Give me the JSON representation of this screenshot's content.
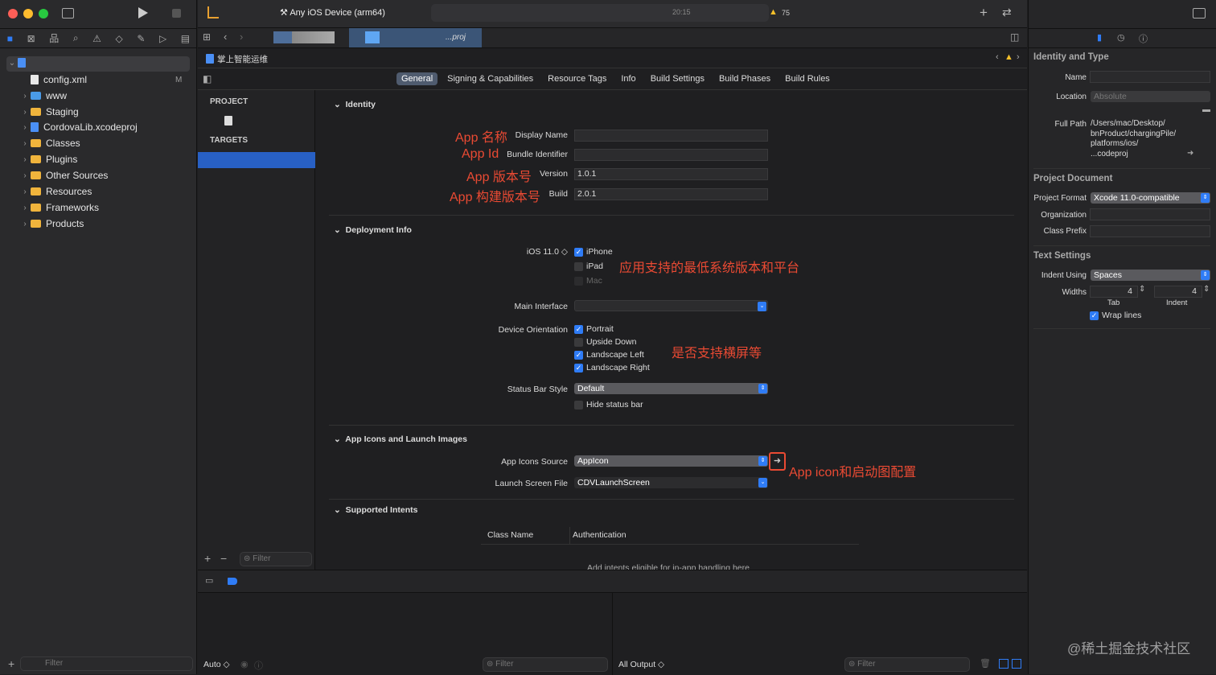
{
  "toolbar": {
    "scheme_device": "Any iOS Device (arm64)",
    "warning_count": "75",
    "time": "20:15"
  },
  "editor_tabs": [
    {
      "label": "...proj"
    }
  ],
  "jump_bar": {
    "title": "掌上智能运维"
  },
  "navigator": {
    "filter_placeholder": "Filter",
    "items": [
      {
        "label": "config.xml",
        "badge": "M"
      },
      {
        "label": "www"
      },
      {
        "label": "Staging"
      },
      {
        "label": "CordovaLib.xcodeproj"
      },
      {
        "label": "Classes"
      },
      {
        "label": "Plugins"
      },
      {
        "label": "Other Sources"
      },
      {
        "label": "Resources"
      },
      {
        "label": "Frameworks"
      },
      {
        "label": "Products"
      }
    ]
  },
  "segments": [
    "General",
    "Signing & Capabilities",
    "Resource Tags",
    "Info",
    "Build Settings",
    "Build Phases",
    "Build Rules"
  ],
  "targets_panel": {
    "project_header": "PROJECT",
    "targets_header": "TARGETS",
    "filter_placeholder": "Filter"
  },
  "identity": {
    "title": "Identity",
    "display_name_label": "Display Name",
    "bundle_id_label": "Bundle Identifier",
    "version_label": "Version",
    "version": "1.0.1",
    "build_label": "Build",
    "build": "2.0.1"
  },
  "deployment": {
    "title": "Deployment Info",
    "ios_version": "iOS 11.0 ◇",
    "iphone": "iPhone",
    "ipad": "iPad",
    "mac": "Mac",
    "main_interface_label": "Main Interface",
    "orientation_label": "Device Orientation",
    "portrait": "Portrait",
    "upside_down": "Upside Down",
    "landscape_left": "Landscape Left",
    "landscape_right": "Landscape Right",
    "status_bar_label": "Status Bar Style",
    "status_bar_value": "Default",
    "hide_status": "Hide status bar"
  },
  "app_icons": {
    "title": "App Icons and Launch Images",
    "icons_source_label": "App Icons Source",
    "icons_source": "AppIcon",
    "launch_label": "Launch Screen File",
    "launch_value": "CDVLaunchScreen"
  },
  "intents": {
    "title": "Supported Intents",
    "col_class": "Class Name",
    "col_auth": "Authentication",
    "empty": "Add intents eligible for in-app handling here"
  },
  "annotations": {
    "app_name": "App 名称",
    "app_id": "App Id",
    "app_version": "App 版本号",
    "app_build": "App 构建版本号",
    "min_os": "应用支持的最低系统版本和平台",
    "landscape": "是否支持横屏等",
    "icon": "App icon和启动图配置"
  },
  "debug": {
    "auto": "Auto ◇",
    "filter": "Filter",
    "all_output": "All Output ◇"
  },
  "inspector": {
    "identity_title": "Identity and Type",
    "name_label": "Name",
    "location_label": "Location",
    "location_value": "Absolute",
    "full_path_label": "Full Path",
    "full_path": [
      "/Users/mac/Desktop/",
      "bnProduct/chargingPile/",
      "platforms/ios/",
      "...codeproj"
    ],
    "project_doc_title": "Project Document",
    "format_label": "Project Format",
    "format_value": "Xcode 11.0-compatible",
    "org_label": "Organization",
    "prefix_label": "Class Prefix",
    "text_title": "Text Settings",
    "indent_using_label": "Indent Using",
    "indent_using": "Spaces",
    "widths_label": "Widths",
    "tab_width": "4",
    "indent_width": "4",
    "tab_label": "Tab",
    "indent_label": "Indent",
    "wrap_lines": "Wrap lines"
  },
  "watermark": "@稀土掘金技术社区"
}
